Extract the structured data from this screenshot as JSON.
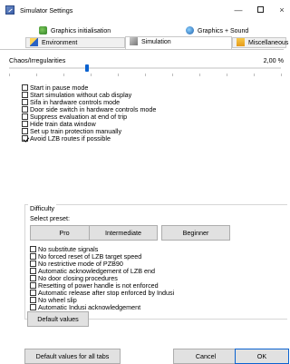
{
  "window": {
    "title": "Simulator Settings",
    "min_glyph": "—",
    "close_glyph": "×"
  },
  "tabs": {
    "row1": [
      {
        "label": "Graphics initialisation",
        "icon": "display-adapter-icon"
      },
      {
        "label": "Graphics + Sound",
        "icon": "globe-icon"
      }
    ],
    "row2": [
      {
        "label": "Environment",
        "icon": "environment-icon"
      },
      {
        "label": "Simulation",
        "icon": "simulation-icon",
        "selected": true
      },
      {
        "label": "Miscellaneous",
        "icon": "folder-icon"
      }
    ]
  },
  "slider": {
    "label": "Chaos/Irregularities",
    "value": "2,00 %",
    "position_fraction": 0.28
  },
  "options": [
    {
      "label": "Start in pause mode",
      "checked": false
    },
    {
      "label": "Start simulation without cab display",
      "checked": false
    },
    {
      "label": "Sifa in hardware controls mode",
      "checked": false
    },
    {
      "label": "Door side switch in hardware controls mode",
      "checked": false
    },
    {
      "label": "Suppress evaluation at end of trip",
      "checked": false
    },
    {
      "label": "Hide train data window",
      "checked": false
    },
    {
      "label": "Set up train protection manually",
      "checked": false
    },
    {
      "label": "Avoid LZB routes if possible",
      "checked": true
    }
  ],
  "difficulty": {
    "title": "Difficulty",
    "preset_label": "Select preset:",
    "presets": [
      "Pro",
      "Intermediate",
      "Beginner"
    ],
    "options": [
      {
        "label": "No substitute signals",
        "checked": false
      },
      {
        "label": "No forced reset of LZB target speed",
        "checked": false
      },
      {
        "label": "No restrictive mode of PZB90",
        "checked": false
      },
      {
        "label": "Automatic acknowledgement of LZB end",
        "checked": false
      },
      {
        "label": "No door closing procedures",
        "checked": false
      },
      {
        "label": "Resetting of power handle is not enforced",
        "checked": false
      },
      {
        "label": "Automatic release after stop enforced by Indusi",
        "checked": false
      },
      {
        "label": "No wheel slip",
        "checked": false
      },
      {
        "label": "Automatic Indusi acknowledgement",
        "checked": false
      }
    ],
    "default_label": "Default values"
  },
  "footer": {
    "default_all_label": "Default values for all tabs",
    "cancel_label": "Cancel",
    "ok_label": "OK"
  },
  "colors": {
    "accent": "#0a62d0",
    "button_bg": "#e1e1e1"
  }
}
